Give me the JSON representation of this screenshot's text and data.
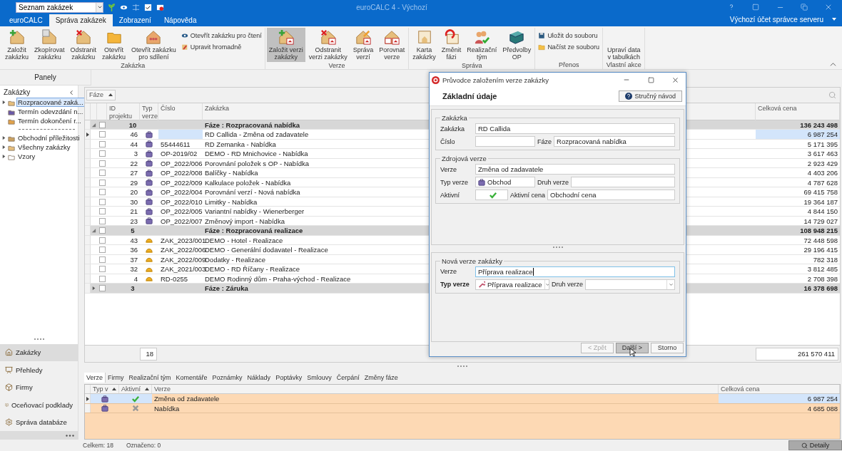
{
  "titlebar": {
    "view_selector": "Seznam zakázek",
    "title": "euroCALC 4 - Výchozí"
  },
  "ribbon_tabs": [
    {
      "label": "euroCALC",
      "selected": false
    },
    {
      "label": "Správa zakázek",
      "selected": true
    },
    {
      "label": "Zobrazení",
      "selected": false
    },
    {
      "label": "Nápověda",
      "selected": false
    }
  ],
  "account": "Výchozí účet správce serveru",
  "ribbon_groups": [
    {
      "label": "Zakázka",
      "items": [
        {
          "kind": "large",
          "lines": [
            "Založit",
            "zakázku"
          ],
          "pressed": false
        },
        {
          "kind": "large",
          "lines": [
            "Zkopírovat",
            "zakázku"
          ],
          "pressed": false
        },
        {
          "kind": "large",
          "lines": [
            "Odstranit",
            "zakázku"
          ],
          "pressed": false
        },
        {
          "kind": "large",
          "lines": [
            "Otevřít",
            "zakázku"
          ],
          "pressed": false
        },
        {
          "kind": "large",
          "lines": [
            "Otevřít zakázku",
            "pro sdílení"
          ],
          "pressed": false
        },
        {
          "kind": "small",
          "lines": [
            "Otevřít zakázku pro čtení"
          ],
          "pressed": false
        },
        {
          "kind": "small",
          "lines": [
            "Upravit hromadně"
          ],
          "pressed": false
        }
      ]
    },
    {
      "label": "Verze",
      "items": [
        {
          "kind": "large",
          "lines": [
            "Založit verzi",
            "zakázky"
          ],
          "pressed": true
        },
        {
          "kind": "large",
          "lines": [
            "Odstranit",
            "verzi zakázky"
          ],
          "pressed": false
        },
        {
          "kind": "large",
          "lines": [
            "Správa",
            "verzí"
          ],
          "pressed": false
        },
        {
          "kind": "large",
          "lines": [
            "Porovnat",
            "verze"
          ],
          "pressed": false
        }
      ]
    },
    {
      "label": "Správa",
      "items": [
        {
          "kind": "large",
          "lines": [
            "Karta",
            "zakázky"
          ],
          "pressed": false
        },
        {
          "kind": "large",
          "lines": [
            "Změnit",
            "fázi"
          ],
          "pressed": false
        },
        {
          "kind": "large",
          "lines": [
            "Realizační",
            "tým"
          ],
          "pressed": false
        },
        {
          "kind": "large",
          "lines": [
            "Předvolby",
            "OP"
          ],
          "pressed": false
        }
      ]
    },
    {
      "label": "Přenos",
      "items": [
        {
          "kind": "small",
          "lines": [
            "Uložit do souboru"
          ],
          "pressed": false
        },
        {
          "kind": "small",
          "lines": [
            "Načíst ze souboru"
          ],
          "pressed": false
        }
      ]
    },
    {
      "label": "Vlastní akce",
      "items": [
        {
          "kind": "plain",
          "lines": [
            "Upraví data",
            "v tabulkách"
          ],
          "pressed": false
        }
      ]
    }
  ],
  "panels": {
    "title": "Panely",
    "section": "Zakázky",
    "tree": [
      {
        "label": "Rozpracované zaká...",
        "has_children": true,
        "selected": true
      },
      {
        "label": "Termín odevzdání n...",
        "has_children": false,
        "selected": false
      },
      {
        "label": "Termín dokončení r...",
        "has_children": false,
        "selected": false
      },
      {
        "label": "Obchodní příležitosti",
        "has_children": true,
        "selected": false
      },
      {
        "label": "Všechny zakázky",
        "has_children": true,
        "selected": false
      },
      {
        "label": "Vzory",
        "has_children": true,
        "selected": false
      }
    ],
    "nav": [
      {
        "label": "Zakázky",
        "selected": true
      },
      {
        "label": "Přehledy",
        "selected": false
      },
      {
        "label": "Firmy",
        "selected": false
      },
      {
        "label": "Oceňovací podklady",
        "selected": false
      },
      {
        "label": "Správa databáze",
        "selected": false
      }
    ]
  },
  "grid": {
    "filter_chip": "Fáze",
    "columns": [
      "ID projektu",
      "Typ verze",
      "Číslo",
      "Zakázka",
      "Celková cena"
    ],
    "rows": [
      {
        "kind": "group",
        "expanded": true,
        "checked": false,
        "count": "10",
        "label": "Fáze : Rozpracovaná nabídka",
        "total": "136 243 498"
      },
      {
        "kind": "obchod",
        "selected": true,
        "checked": false,
        "id": "46",
        "order": "RD Callida - Změna od zadavatele",
        "price": "6 987 254"
      },
      {
        "kind": "obchod",
        "selected": false,
        "checked": false,
        "id": "44",
        "number": "55444611",
        "order": "RD Zemanka - Nabídka",
        "price": "5 171 395"
      },
      {
        "kind": "obchod",
        "selected": false,
        "checked": false,
        "id": "3",
        "number": "OP-2019/02",
        "order": "DEMO - RD Mnichovice - Nabídka",
        "price": "3 617 463"
      },
      {
        "kind": "obchod",
        "selected": false,
        "checked": false,
        "id": "22",
        "number": "OP_2022/006",
        "order": "Porovnání položek s OP - Nabídka",
        "price": "2 923 429"
      },
      {
        "kind": "obchod",
        "selected": false,
        "checked": false,
        "id": "27",
        "number": "OP_2022/008",
        "order": "Balíčky - Nabídka",
        "price": "4 403 206"
      },
      {
        "kind": "obchod",
        "selected": false,
        "checked": false,
        "id": "29",
        "number": "OP_2022/009",
        "order": "Kalkulace položek - Nabídka",
        "price": "4 787 628"
      },
      {
        "kind": "obchod",
        "selected": false,
        "checked": false,
        "id": "20",
        "number": "OP_2022/004",
        "order": "Porovnání verzí - Nová nabídka",
        "price": "69 415 758"
      },
      {
        "kind": "obchod",
        "selected": false,
        "checked": false,
        "id": "30",
        "number": "OP_2022/010",
        "order": "Limitky - Nabídka",
        "price": "19 364 187"
      },
      {
        "kind": "obchod",
        "selected": false,
        "checked": false,
        "id": "21",
        "number": "OP_2022/005",
        "order": "Variantní nabídky - Wienerberger",
        "price": "4 844 150"
      },
      {
        "kind": "obchod",
        "selected": false,
        "checked": false,
        "id": "23",
        "number": "OP_2022/007",
        "order": "Změnový import - Nabídka",
        "price": "14 729 027"
      },
      {
        "kind": "group",
        "expanded": true,
        "checked": false,
        "count": "5",
        "label": "Fáze : Rozpracovaná realizace",
        "total": "108 948 215"
      },
      {
        "kind": "realizace",
        "selected": false,
        "checked": false,
        "id": "43",
        "number": "ZAK_2023/001",
        "order": "DEMO - Hotel - Realizace",
        "price": "72 448 598"
      },
      {
        "kind": "realizace",
        "selected": false,
        "checked": false,
        "id": "36",
        "number": "ZAK_2022/006",
        "order": "DEMO - Generální dodavatel - Realizace",
        "price": "29 196 415"
      },
      {
        "kind": "realizace",
        "selected": false,
        "checked": false,
        "id": "37",
        "number": "ZAK_2022/009",
        "order": "Dodatky - Realizace",
        "price": "782 318"
      },
      {
        "kind": "realizace",
        "selected": false,
        "checked": false,
        "id": "32",
        "number": "ZAK_2021/003",
        "order": "DEMO - RD Říčany - Realizace",
        "price": "3 812 485"
      },
      {
        "kind": "realizace",
        "selected": false,
        "checked": false,
        "id": "4",
        "number": "RD-0255",
        "order": "DEMO Rodinný dům - Praha-východ - Realizace",
        "price": "2 708 398"
      },
      {
        "kind": "group",
        "expanded": false,
        "checked": false,
        "count": "3",
        "label": "Fáze : Záruka",
        "total": "16 378 698"
      }
    ],
    "footer_count": "18",
    "footer_total": "261 570 411"
  },
  "detail_tabs": [
    {
      "label": "Verze",
      "selected": true
    },
    {
      "label": "Firmy",
      "selected": false
    },
    {
      "label": "Realizační tým",
      "selected": false
    },
    {
      "label": "Komentáře",
      "selected": false
    },
    {
      "label": "Poznámky",
      "selected": false
    },
    {
      "label": "Náklady",
      "selected": false
    },
    {
      "label": "Poptávky",
      "selected": false
    },
    {
      "label": "Smlouvy",
      "selected": false
    },
    {
      "label": "Čerpání",
      "selected": false
    },
    {
      "label": "Změny fáze",
      "selected": false
    }
  ],
  "versions": {
    "columns": [
      {
        "label": "Typ v",
        "sorted": true
      },
      {
        "label": "Aktivní",
        "sorted": true
      },
      {
        "label": "Verze",
        "sorted": false
      },
      {
        "label": "Celková cena",
        "sorted": false
      }
    ],
    "rows": [
      {
        "selected": true,
        "kind": "obchod",
        "active": true,
        "name": "Změna od zadavatele",
        "price": "6 987 254"
      },
      {
        "selected": false,
        "kind": "obchod",
        "active": false,
        "name": "Nabídka",
        "price": "4 685 088"
      }
    ]
  },
  "status": {
    "total": "Celkem: 18",
    "marked": "Označeno: 0",
    "details_button": "Detaily"
  },
  "dialog": {
    "title": "Průvodce založením verze zakázky",
    "heading": "Základní údaje",
    "help_button": "Stručný návod",
    "upper_sections": [
      {
        "legend": "Zakázka",
        "rows": [
          [
            {
              "kind": "text",
              "label": "Zakázka",
              "value": "RD Callida",
              "bold": false
            }
          ],
          [
            {
              "kind": "text",
              "label": "Číslo",
              "bold": false
            },
            {
              "kind": "text",
              "label": "Fáze",
              "value": "Rozpracovaná nabídka",
              "bold": false
            }
          ]
        ]
      },
      {
        "legend": "Zdrojová verze",
        "rows": [
          [
            {
              "kind": "text",
              "label": "Verze",
              "value": "Změna od zadavatele",
              "bold": false
            }
          ],
          [
            {
              "kind": "type",
              "label": "Typ verze",
              "value": "Obchod",
              "icon": {
                "kind": "obchod"
              },
              "bold": false
            },
            {
              "kind": "text",
              "label": "Druh verze",
              "bold": false
            }
          ],
          [
            {
              "kind": "check",
              "label": "Aktivní",
              "checked": true,
              "bold": false
            },
            {
              "kind": "text",
              "label": "Aktivní cena",
              "value": "Obchodní cena",
              "bold": false
            }
          ]
        ]
      }
    ],
    "lower_sections": [
      {
        "legend": "Nová verze zakázky",
        "rows": [
          [
            {
              "kind": "input",
              "label": "Verze",
              "value": "Příprava realizace",
              "bold": false
            }
          ],
          [
            {
              "kind": "dropdown",
              "label": "Typ verze",
              "value": "Příprava realizace",
              "icon": {
                "kind": "priprava"
              },
              "bold": true
            },
            {
              "kind": "dropdown",
              "label": "Druh verze",
              "bold": false
            }
          ]
        ]
      }
    ],
    "buttons": [
      {
        "label": "< Zpět",
        "disabled": true,
        "hovered": false
      },
      {
        "label": "Další >",
        "disabled": false,
        "hovered": true
      },
      {
        "label": "Storno",
        "disabled": false,
        "hovered": false
      }
    ]
  }
}
